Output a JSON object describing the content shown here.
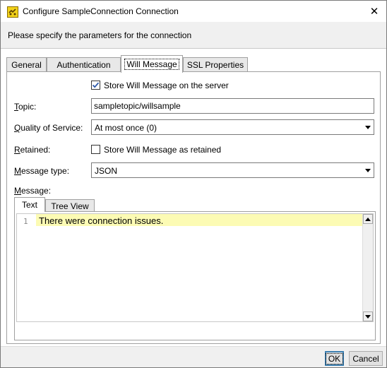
{
  "window": {
    "title": "Configure SampleConnection Connection",
    "header": "Please specify the parameters for the connection"
  },
  "tabs": [
    {
      "label": "General"
    },
    {
      "label": "Authentication"
    },
    {
      "label": "Will Message"
    },
    {
      "label": "SSL Properties"
    }
  ],
  "will_message": {
    "store_on_server_label": "Store Will Message on the server",
    "store_on_server_checked": true,
    "topic_label": "Topic:",
    "topic_value": "sampletopic/willsample",
    "qos_label": "Quality of Service:",
    "qos_value": "At most once (0)",
    "retained_label": "Retained:",
    "retained_checkbox_label": "Store Will Message as retained",
    "retained_checked": false,
    "message_type_label": "Message type:",
    "message_type_value": "JSON",
    "message_label": "Message:"
  },
  "editor": {
    "tabs": [
      {
        "label": "Text"
      },
      {
        "label": "Tree View"
      }
    ],
    "line_number": "1",
    "line_text": "There were connection issues."
  },
  "footer": {
    "ok_label": "OK",
    "cancel_label": "Cancel"
  },
  "colors": {
    "line_highlight": "#fcfbb4",
    "check_mark": "#2a56a8",
    "primary_border": "#3c7fb1"
  },
  "icons": {
    "app": "app-icon",
    "close": "close-icon",
    "dropdown": "chevron-down-icon",
    "scroll_up": "arrow-up-icon",
    "scroll_down": "arrow-down-icon",
    "check": "check-icon"
  }
}
